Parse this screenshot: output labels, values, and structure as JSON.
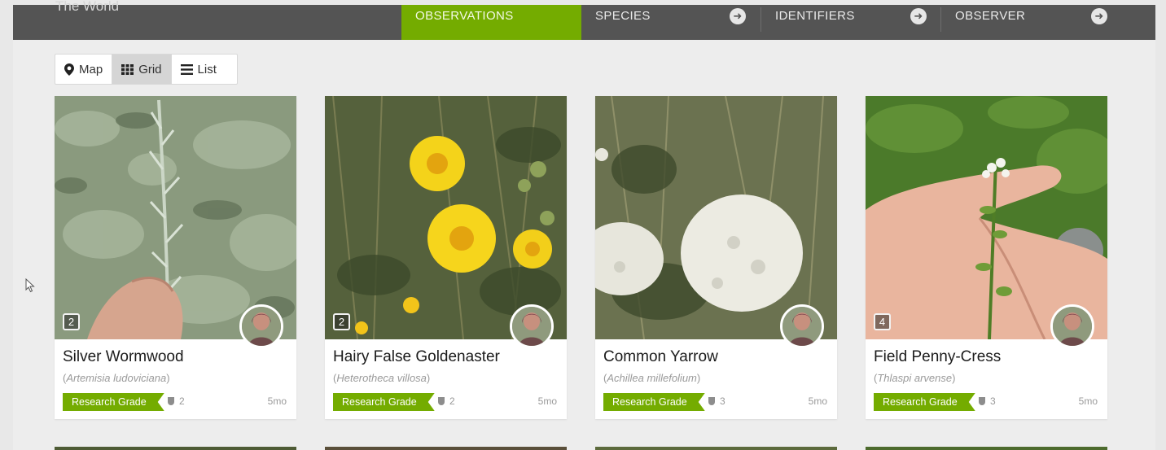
{
  "header": {
    "place": "The World",
    "tabs": [
      {
        "label": "OBSERVATIONS",
        "active": true
      },
      {
        "label": "SPECIES",
        "active": false
      },
      {
        "label": "IDENTIFIERS",
        "active": false
      },
      {
        "label": "OBSERVER",
        "active": false
      }
    ]
  },
  "view_toggle": {
    "map": "Map",
    "grid": "Grid",
    "list": "List",
    "selected": "Grid"
  },
  "observations": [
    {
      "common_name": "Silver Wormwood",
      "open_paren": "(",
      "scientific_name": "Artemisia ludoviciana",
      "close_paren": ")",
      "photo_count": "2",
      "quality": "Research Grade",
      "identifications": "2",
      "age": "5mo"
    },
    {
      "common_name": "Hairy False Goldenaster",
      "open_paren": "(",
      "scientific_name": "Heterotheca villosa",
      "close_paren": ")",
      "photo_count": "2",
      "quality": "Research Grade",
      "identifications": "2",
      "age": "5mo"
    },
    {
      "common_name": "Common Yarrow",
      "open_paren": "(",
      "scientific_name": "Achillea millefolium",
      "close_paren": ")",
      "photo_count": "",
      "quality": "Research Grade",
      "identifications": "3",
      "age": "5mo"
    },
    {
      "common_name": "Field Penny-Cress",
      "open_paren": "(",
      "scientific_name": "Thlaspi arvense",
      "close_paren": ")",
      "photo_count": "4",
      "quality": "Research Grade",
      "identifications": "3",
      "age": "5mo"
    }
  ],
  "colors": {
    "accent": "#74ac00",
    "topbar": "#545454",
    "background": "#ededed"
  }
}
